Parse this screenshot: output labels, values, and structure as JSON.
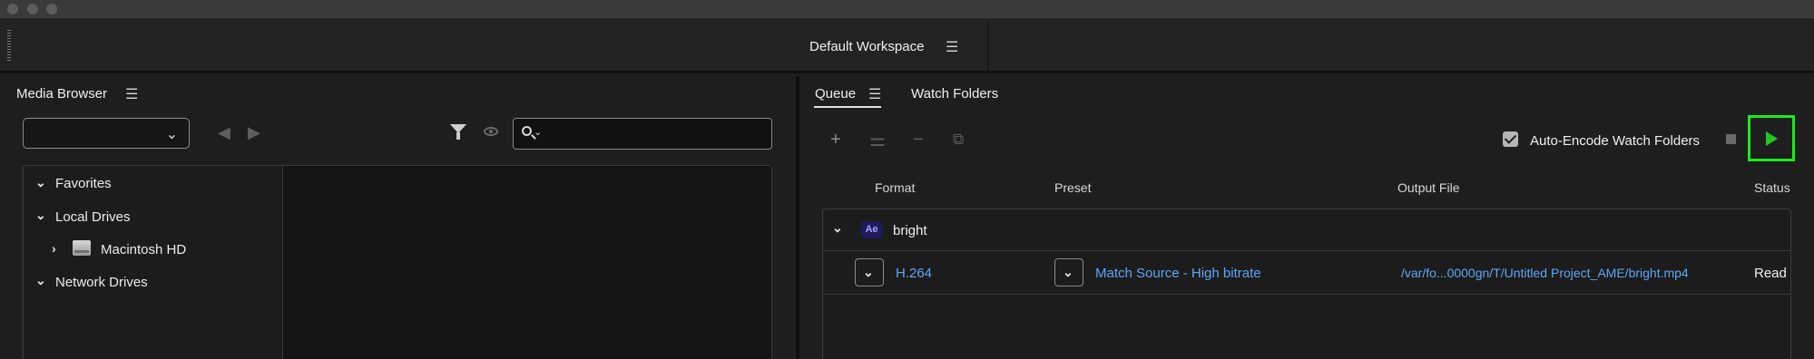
{
  "workspace": {
    "title": "Default Workspace",
    "menu_icon": "hamburger-icon"
  },
  "media_browser": {
    "title": "Media Browser",
    "menu_icon": "hamburger-icon",
    "dropdown_value": "",
    "search": {
      "value": "",
      "placeholder": ""
    },
    "tree": [
      {
        "label": "Favorites",
        "expanded": true
      },
      {
        "label": "Local Drives",
        "expanded": true
      },
      {
        "label": "Macintosh HD",
        "expanded": false,
        "icon": "hard-drive-icon"
      },
      {
        "label": "Network Drives",
        "expanded": true
      }
    ]
  },
  "queue_panel": {
    "tabs": [
      {
        "label": "Queue",
        "active": true
      },
      {
        "label": "Watch Folders",
        "active": false
      }
    ],
    "auto_encode": {
      "label": "Auto-Encode Watch Folders",
      "checked": true
    },
    "columns": {
      "format": "Format",
      "preset": "Preset",
      "output": "Output File",
      "status": "Status"
    },
    "items": [
      {
        "source": "bright",
        "badge": "Ae",
        "format": "H.264",
        "preset": "Match Source - High bitrate",
        "output": "/var/fo...0000gn/T/Untitled Project_AME/bright.mp4",
        "status": "Read"
      }
    ]
  },
  "colors": {
    "accent_link": "#5fa6f5",
    "play_highlight": "#1fe81f",
    "ae_badge_bg": "#1f1a5e",
    "ae_badge_text": "#a3a3ff"
  }
}
